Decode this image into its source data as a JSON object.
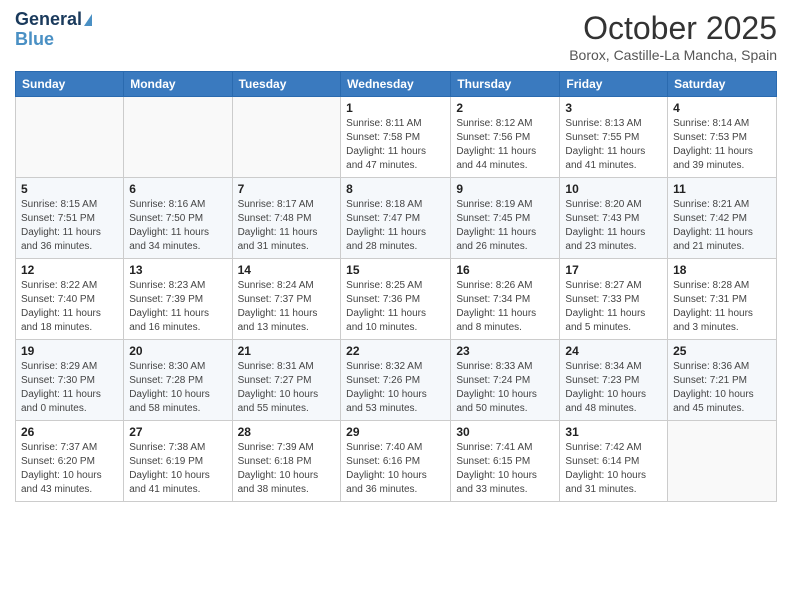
{
  "header": {
    "logo_line1": "General",
    "logo_line2": "Blue",
    "month": "October 2025",
    "location": "Borox, Castille-La Mancha, Spain"
  },
  "weekdays": [
    "Sunday",
    "Monday",
    "Tuesday",
    "Wednesday",
    "Thursday",
    "Friday",
    "Saturday"
  ],
  "weeks": [
    [
      {
        "day": "",
        "info": ""
      },
      {
        "day": "",
        "info": ""
      },
      {
        "day": "",
        "info": ""
      },
      {
        "day": "1",
        "info": "Sunrise: 8:11 AM\nSunset: 7:58 PM\nDaylight: 11 hours and 47 minutes."
      },
      {
        "day": "2",
        "info": "Sunrise: 8:12 AM\nSunset: 7:56 PM\nDaylight: 11 hours and 44 minutes."
      },
      {
        "day": "3",
        "info": "Sunrise: 8:13 AM\nSunset: 7:55 PM\nDaylight: 11 hours and 41 minutes."
      },
      {
        "day": "4",
        "info": "Sunrise: 8:14 AM\nSunset: 7:53 PM\nDaylight: 11 hours and 39 minutes."
      }
    ],
    [
      {
        "day": "5",
        "info": "Sunrise: 8:15 AM\nSunset: 7:51 PM\nDaylight: 11 hours and 36 minutes."
      },
      {
        "day": "6",
        "info": "Sunrise: 8:16 AM\nSunset: 7:50 PM\nDaylight: 11 hours and 34 minutes."
      },
      {
        "day": "7",
        "info": "Sunrise: 8:17 AM\nSunset: 7:48 PM\nDaylight: 11 hours and 31 minutes."
      },
      {
        "day": "8",
        "info": "Sunrise: 8:18 AM\nSunset: 7:47 PM\nDaylight: 11 hours and 28 minutes."
      },
      {
        "day": "9",
        "info": "Sunrise: 8:19 AM\nSunset: 7:45 PM\nDaylight: 11 hours and 26 minutes."
      },
      {
        "day": "10",
        "info": "Sunrise: 8:20 AM\nSunset: 7:43 PM\nDaylight: 11 hours and 23 minutes."
      },
      {
        "day": "11",
        "info": "Sunrise: 8:21 AM\nSunset: 7:42 PM\nDaylight: 11 hours and 21 minutes."
      }
    ],
    [
      {
        "day": "12",
        "info": "Sunrise: 8:22 AM\nSunset: 7:40 PM\nDaylight: 11 hours and 18 minutes."
      },
      {
        "day": "13",
        "info": "Sunrise: 8:23 AM\nSunset: 7:39 PM\nDaylight: 11 hours and 16 minutes."
      },
      {
        "day": "14",
        "info": "Sunrise: 8:24 AM\nSunset: 7:37 PM\nDaylight: 11 hours and 13 minutes."
      },
      {
        "day": "15",
        "info": "Sunrise: 8:25 AM\nSunset: 7:36 PM\nDaylight: 11 hours and 10 minutes."
      },
      {
        "day": "16",
        "info": "Sunrise: 8:26 AM\nSunset: 7:34 PM\nDaylight: 11 hours and 8 minutes."
      },
      {
        "day": "17",
        "info": "Sunrise: 8:27 AM\nSunset: 7:33 PM\nDaylight: 11 hours and 5 minutes."
      },
      {
        "day": "18",
        "info": "Sunrise: 8:28 AM\nSunset: 7:31 PM\nDaylight: 11 hours and 3 minutes."
      }
    ],
    [
      {
        "day": "19",
        "info": "Sunrise: 8:29 AM\nSunset: 7:30 PM\nDaylight: 11 hours and 0 minutes."
      },
      {
        "day": "20",
        "info": "Sunrise: 8:30 AM\nSunset: 7:28 PM\nDaylight: 10 hours and 58 minutes."
      },
      {
        "day": "21",
        "info": "Sunrise: 8:31 AM\nSunset: 7:27 PM\nDaylight: 10 hours and 55 minutes."
      },
      {
        "day": "22",
        "info": "Sunrise: 8:32 AM\nSunset: 7:26 PM\nDaylight: 10 hours and 53 minutes."
      },
      {
        "day": "23",
        "info": "Sunrise: 8:33 AM\nSunset: 7:24 PM\nDaylight: 10 hours and 50 minutes."
      },
      {
        "day": "24",
        "info": "Sunrise: 8:34 AM\nSunset: 7:23 PM\nDaylight: 10 hours and 48 minutes."
      },
      {
        "day": "25",
        "info": "Sunrise: 8:36 AM\nSunset: 7:21 PM\nDaylight: 10 hours and 45 minutes."
      }
    ],
    [
      {
        "day": "26",
        "info": "Sunrise: 7:37 AM\nSunset: 6:20 PM\nDaylight: 10 hours and 43 minutes."
      },
      {
        "day": "27",
        "info": "Sunrise: 7:38 AM\nSunset: 6:19 PM\nDaylight: 10 hours and 41 minutes."
      },
      {
        "day": "28",
        "info": "Sunrise: 7:39 AM\nSunset: 6:18 PM\nDaylight: 10 hours and 38 minutes."
      },
      {
        "day": "29",
        "info": "Sunrise: 7:40 AM\nSunset: 6:16 PM\nDaylight: 10 hours and 36 minutes."
      },
      {
        "day": "30",
        "info": "Sunrise: 7:41 AM\nSunset: 6:15 PM\nDaylight: 10 hours and 33 minutes."
      },
      {
        "day": "31",
        "info": "Sunrise: 7:42 AM\nSunset: 6:14 PM\nDaylight: 10 hours and 31 minutes."
      },
      {
        "day": "",
        "info": ""
      }
    ]
  ]
}
